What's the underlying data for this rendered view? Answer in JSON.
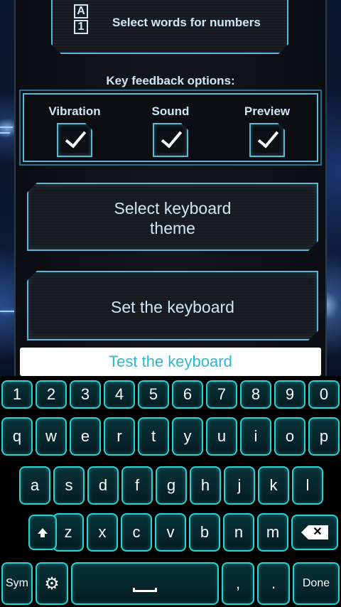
{
  "settings": {
    "icon_letters": [
      "A",
      "1"
    ],
    "select_words_label": "Select words for numbers",
    "key_feedback_title": "Key feedback options:",
    "feedback_options": [
      {
        "label": "Vibration",
        "checked": true
      },
      {
        "label": "Sound",
        "checked": true
      },
      {
        "label": "Preview",
        "checked": true
      }
    ],
    "select_theme_line1": "Select keyboard",
    "select_theme_line2": "theme",
    "set_keyboard_label": "Set the keyboard",
    "test_field_placeholder": "Test the keyboard"
  },
  "keyboard": {
    "row_numbers": [
      "1",
      "2",
      "3",
      "4",
      "5",
      "6",
      "7",
      "8",
      "9",
      "0"
    ],
    "row_qwerty": [
      "q",
      "w",
      "e",
      "r",
      "t",
      "y",
      "u",
      "i",
      "o",
      "p"
    ],
    "row_asdf": [
      "a",
      "s",
      "d",
      "f",
      "g",
      "h",
      "j",
      "k",
      "l"
    ],
    "row_zxcv": [
      "z",
      "x",
      "c",
      "v",
      "b",
      "n",
      "m"
    ],
    "sym_label": "Sym",
    "comma_label": ",",
    "period_label": ".",
    "done_label": "Done",
    "shift_icon": "shift-icon",
    "delete_icon": "backspace-icon",
    "settings_icon": "gear-icon",
    "space_icon": "space-icon"
  },
  "colors": {
    "accent": "#27d4d4",
    "frame": "#5fb5d6",
    "text": "#cfe6f5",
    "placeholder": "#2fb6d4"
  }
}
